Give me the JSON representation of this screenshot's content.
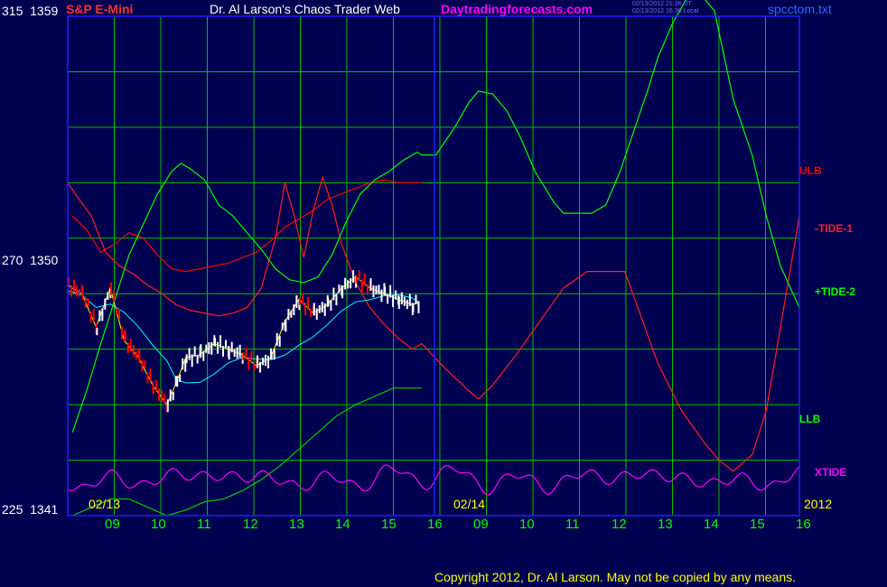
{
  "header": {
    "symbol": "S&P E-Mini",
    "title": "Dr. Al Larson's Chaos Trader Web",
    "site": "Daytradingforecasts.com",
    "file": "spcctom.txt",
    "timestamp_ut": "02/13/2012 21:36 UT",
    "timestamp_local": "02/13/2012 16:36 Local"
  },
  "colors": {
    "background": "#000050",
    "grid": "#00c000",
    "frame": "#2020ff",
    "ulb": "#ff0000",
    "tide1": "#ff2020",
    "tide2": "#00ff00",
    "llb": "#00cc00",
    "xtide": "#ff00ff",
    "avg_fast": "#ffff00",
    "avg_slow": "#00ffff",
    "bars": "#ffffff",
    "bars_down": "#ff0000",
    "copyright": "#ffff00"
  },
  "y_axis": {
    "ticks": [
      {
        "index": "315",
        "price": "1359"
      },
      {
        "index": "270",
        "price": "1350"
      },
      {
        "index": "225",
        "price": "1341"
      }
    ]
  },
  "x_axis": {
    "hours": [
      "09",
      "10",
      "11",
      "12",
      "13",
      "14",
      "15",
      "16",
      "09",
      "10",
      "11",
      "12",
      "13",
      "14",
      "15",
      "16"
    ],
    "dates": [
      "02/13",
      "02/14"
    ],
    "year": "2012"
  },
  "series_labels": {
    "ulb": "ULB",
    "tide1": "-TIDE-1",
    "tide2": "+TIDE-2",
    "llb": "LLB",
    "xtide": "XTIDE"
  },
  "footer": {
    "copyright": "Copyright 2012, Dr. Al Larson.  May not be copied by any means."
  },
  "chart_data": {
    "type": "line",
    "ylim": [
      1341,
      1359
    ],
    "x_range_hours": [
      8.5,
      24
    ],
    "series": [
      {
        "name": "ULB",
        "x": [
          8.6,
          8.9,
          9.2,
          9.5,
          9.8,
          10.1,
          10.4,
          10.7,
          11.0,
          11.3,
          11.6,
          11.9,
          12.2,
          12.5,
          12.8,
          13.1,
          13.4,
          13.7,
          14.0,
          14.3,
          14.6,
          14.9,
          15.2,
          15.5,
          15.8,
          16.0
        ],
        "y": [
          1351.8,
          1351.3,
          1350.5,
          1350.8,
          1351.2,
          1351.0,
          1350.4,
          1349.9,
          1349.8,
          1349.9,
          1350.0,
          1350.1,
          1350.3,
          1350.5,
          1350.9,
          1351.4,
          1351.7,
          1352.0,
          1352.4,
          1352.6,
          1352.8,
          1353.0,
          1353.1,
          1353.0,
          1353.0,
          1353.0
        ]
      },
      {
        "name": "-TIDE-1",
        "x": [
          8.5,
          8.7,
          9.0,
          9.3,
          9.6,
          9.9,
          10.2,
          10.5,
          10.8,
          11.1,
          11.4,
          11.7,
          12.0,
          12.3,
          12.6,
          12.9,
          13.1,
          13.3,
          13.5,
          13.7,
          13.9,
          14.1,
          14.3,
          14.6,
          14.9,
          15.2,
          15.5,
          15.8,
          16.0,
          16.5,
          17.0,
          17.2,
          17.5,
          18.0,
          18.5,
          19.0,
          19.5,
          19.8,
          20.0,
          20.3,
          20.6,
          21.0,
          21.5,
          22.0,
          22.3,
          22.6,
          23.0,
          23.3,
          23.6,
          24.0
        ],
        "y": [
          1353.0,
          1352.5,
          1351.8,
          1350.5,
          1350.0,
          1349.7,
          1349.3,
          1349.0,
          1348.6,
          1348.4,
          1348.3,
          1348.2,
          1348.3,
          1348.5,
          1349.2,
          1351.0,
          1353.0,
          1351.8,
          1350.3,
          1352.0,
          1353.2,
          1352.2,
          1350.8,
          1349.4,
          1348.5,
          1347.9,
          1347.4,
          1347.0,
          1347.2,
          1346.3,
          1345.5,
          1345.2,
          1345.7,
          1346.8,
          1348.0,
          1349.2,
          1349.8,
          1349.8,
          1349.8,
          1349.8,
          1348.4,
          1346.5,
          1344.8,
          1343.6,
          1343.0,
          1342.6,
          1343.2,
          1344.8,
          1347.8,
          1351.8
        ]
      },
      {
        "name": "+TIDE-2",
        "x": [
          8.6,
          8.9,
          9.2,
          9.5,
          9.8,
          10.1,
          10.4,
          10.7,
          10.9,
          11.1,
          11.4,
          11.7,
          12.0,
          12.3,
          12.6,
          12.9,
          13.2,
          13.5,
          13.8,
          14.1,
          14.4,
          14.7,
          15.0,
          15.3,
          15.6,
          15.9,
          16.0,
          16.3,
          16.7,
          17.0,
          17.2,
          17.5,
          17.8,
          18.1,
          18.4,
          18.8,
          19.0,
          19.3,
          19.6,
          19.9,
          20.2,
          20.5,
          20.8,
          21.0,
          21.3,
          21.6,
          21.9,
          22.2,
          22.6,
          23.0,
          23.3,
          23.6,
          24.0
        ],
        "y": [
          1344.0,
          1345.5,
          1347.2,
          1348.8,
          1350.4,
          1351.5,
          1352.6,
          1353.4,
          1353.7,
          1353.5,
          1353.1,
          1352.2,
          1351.8,
          1351.2,
          1350.6,
          1349.9,
          1349.5,
          1349.4,
          1349.6,
          1350.4,
          1351.6,
          1352.6,
          1353.1,
          1353.4,
          1353.8,
          1354.1,
          1354.0,
          1354.0,
          1355.0,
          1355.9,
          1356.3,
          1356.2,
          1355.6,
          1354.6,
          1353.4,
          1352.3,
          1351.9,
          1351.9,
          1351.9,
          1352.2,
          1353.4,
          1354.9,
          1356.4,
          1357.5,
          1358.7,
          1359.6,
          1359.8,
          1359.2,
          1356.0,
          1354.0,
          1351.8,
          1350.0,
          1348.5
        ]
      },
      {
        "name": "LLB",
        "x": [
          8.6,
          9.0,
          9.4,
          9.8,
          10.2,
          10.6,
          11.0,
          11.4,
          11.8,
          12.2,
          12.6,
          13.0,
          13.4,
          13.8,
          14.2,
          14.6,
          15.0,
          15.4,
          15.8,
          16.0
        ],
        "y": [
          1341.0,
          1341.3,
          1341.6,
          1341.6,
          1341.3,
          1341.0,
          1341.2,
          1341.5,
          1341.6,
          1341.9,
          1342.3,
          1342.8,
          1343.4,
          1344.0,
          1344.6,
          1345.0,
          1345.3,
          1345.6,
          1345.6,
          1345.6
        ]
      },
      {
        "name": "XTIDE",
        "x": [
          8.5,
          24.0
        ],
        "y": [
          1341.6,
          1342.2
        ],
        "style": "oscillating"
      },
      {
        "name": "price",
        "x": [
          8.5,
          8.8,
          9.1,
          9.4,
          9.7,
          10.0,
          10.3,
          10.6,
          10.8,
          11.0,
          11.3,
          11.6,
          11.9,
          12.2,
          12.5,
          12.8,
          13.1,
          13.4,
          13.7,
          14.0,
          14.3,
          14.6,
          14.9,
          15.2,
          15.5,
          15.8,
          15.95
        ],
        "y": [
          1349.3,
          1349.0,
          1347.8,
          1349.2,
          1347.3,
          1346.7,
          1345.7,
          1345.0,
          1345.8,
          1346.7,
          1346.8,
          1347.2,
          1347.0,
          1346.8,
          1346.4,
          1346.7,
          1348.0,
          1348.8,
          1348.3,
          1348.6,
          1349.2,
          1349.6,
          1349.2,
          1349.0,
          1348.8,
          1348.6,
          1348.7
        ]
      }
    ]
  }
}
